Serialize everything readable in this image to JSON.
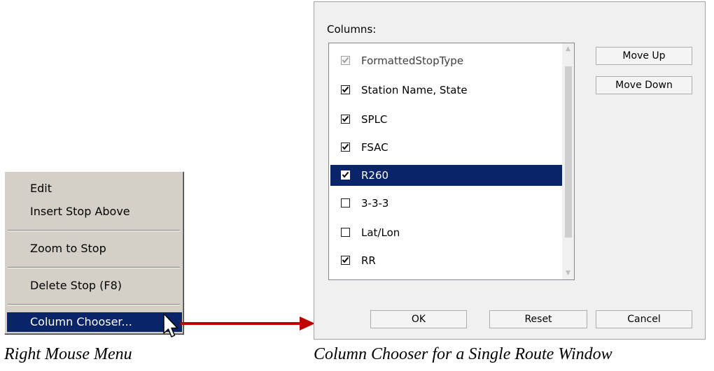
{
  "context_menu": {
    "items": [
      {
        "label": "Edit"
      },
      {
        "label": "Insert Stop Above"
      },
      {
        "label": "Zoom to Stop"
      },
      {
        "label": "Delete Stop (F8)"
      },
      {
        "label": "Column Chooser..."
      }
    ],
    "highlighted_item": "Column Chooser..."
  },
  "dialog": {
    "columns_label": "Columns:",
    "columns": [
      {
        "label": "FormattedStopType",
        "checked": true,
        "disabled": true
      },
      {
        "label": "Station Name, State",
        "checked": true
      },
      {
        "label": "SPLC",
        "checked": true
      },
      {
        "label": "FSAC",
        "checked": true
      },
      {
        "label": "R260",
        "checked": true,
        "selected": true
      },
      {
        "label": "3-3-3",
        "checked": false
      },
      {
        "label": "Lat/Lon",
        "checked": false
      },
      {
        "label": "RR",
        "checked": true
      }
    ],
    "buttons": {
      "move_up": "Move Up",
      "move_down": "Move Down",
      "ok": "OK",
      "reset": "Reset",
      "cancel": "Cancel"
    }
  },
  "captions": {
    "left": "Right Mouse Menu",
    "right": "Column Chooser for a Single Route Window"
  },
  "colors": {
    "menu_background": "#d4d0c8",
    "selection_highlight": "#0a246a",
    "arrow": "#c00000",
    "dialog_background": "#f0f0f0"
  },
  "icons": [
    "mouse-pointer-icon",
    "arrow-right-icon",
    "checkmark-icon",
    "scroll-up-arrow-icon",
    "scroll-down-arrow-icon"
  ]
}
